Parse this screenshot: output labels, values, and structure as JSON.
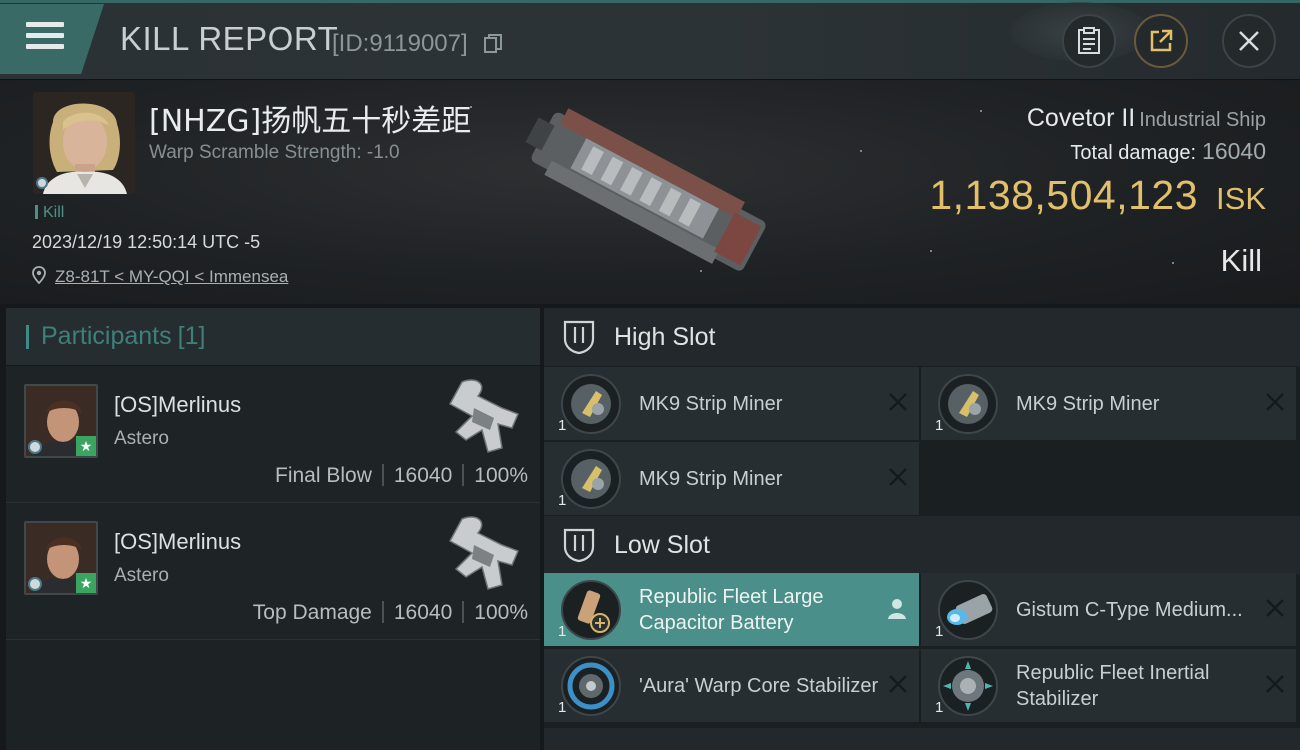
{
  "header": {
    "title": "KILL REPORT",
    "report_id": "[ID:9119007]"
  },
  "victim": {
    "name": "[NHZG]扬帆五十秒差距",
    "warp_scramble": "Warp Scramble Strength: -1.0",
    "kill_tag": "Kill",
    "datetime": "2023/12/19 12:50:14 UTC -5",
    "location": "Z8-81T < MY-QQI < Immensea",
    "ship_name": "Covetor II",
    "ship_class": "Industrial Ship",
    "total_damage_label": "Total damage:",
    "total_damage": "16040",
    "isk_value": "1,138,504,123",
    "isk_unit": "ISK",
    "result": "Kill"
  },
  "participants": {
    "title": "Participants",
    "count": "[1]",
    "rows": [
      {
        "name": "[OS]Merlinus",
        "ship": "Astero",
        "role": "Final Blow",
        "damage": "16040",
        "percent": "100%"
      },
      {
        "name": "[OS]Merlinus",
        "ship": "Astero",
        "role": "Top Damage",
        "damage": "16040",
        "percent": "100%"
      }
    ]
  },
  "fitting": {
    "high_slot": {
      "title": "High Slot",
      "modules": [
        {
          "name": "MK9 Strip Miner",
          "qty": "1"
        },
        {
          "name": "MK9 Strip Miner",
          "qty": "1"
        },
        {
          "name": "MK9 Strip Miner",
          "qty": "1"
        }
      ]
    },
    "low_slot": {
      "title": "Low Slot",
      "modules": [
        {
          "name": "Republic Fleet Large Capacitor Battery",
          "qty": "1",
          "state": "highlighted"
        },
        {
          "name": "Gistum C-Type Medium...",
          "qty": "1"
        },
        {
          "name": "'Aura' Warp Core Stabilizer",
          "qty": "1"
        },
        {
          "name": "Republic Fleet Inertial Stabilizer",
          "qty": "1"
        }
      ]
    }
  },
  "colors": {
    "accent": "#3f8c85",
    "isk_gold": "#e2bf6b",
    "active_module": "#4a8f89",
    "panel": "#272e32"
  }
}
